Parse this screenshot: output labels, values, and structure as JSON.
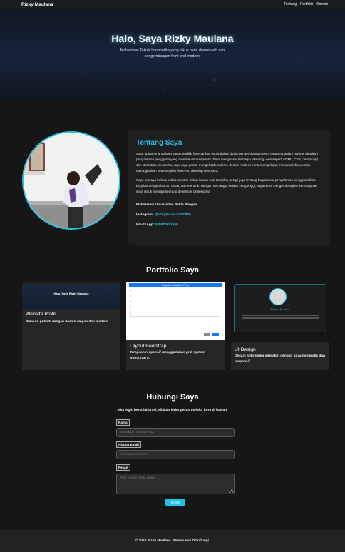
{
  "navbar": {
    "brand": "Rizky Maulana",
    "links": [
      "Tentang",
      "Portfolio",
      "Kontak"
    ]
  },
  "hero": {
    "title": "Halo, Saya Rizky Maulana",
    "subtitle": "Mahasiswa Teknik Informatika yang fokus pada desain web dan pengembangan front-end modern."
  },
  "about": {
    "title": "Tentang Saya",
    "paragraph1": "Saya adalah mahasiswa yang memiliki ketertarikan tinggi dalam dunia pengembangan web, terutama dalam hal menciptakan pengalaman pengguna yang menarik dan responsif. Saya menguasai berbagai teknologi web seperti HTML, CSS, JavaScript, dan Bootstrap. Selain itu, saya juga gemar mengeksplorasi tren desain modern serta mempelajari framework baru untuk meningkatkan keterampilan front-end development saya.",
    "paragraph2": "Saya percaya bahwa setiap website bukan hanya soal tampilan, tetapi juga tentang bagaimana pengalaman pengguna bisa berjalan dengan lancar, cepat, dan menarik. Dengan semangat belajar yang tinggi, saya terus mengembangkan kemampuan saya untuk menjadi seorang developer profesional.",
    "university": "Mahasiswa Universitas Pelita Bangsa",
    "instagram_label": "Instagram:",
    "instagram_value": "@rizkymaulana270805",
    "whatsapp_label": "WhatsApp:",
    "whatsapp_value": "085872651650"
  },
  "portfolio": {
    "title": "Portfolio Saya",
    "items": [
      {
        "title": "Website Profil",
        "desc": "Website pribadi dengan desain elegan dan modern.",
        "thumb_text": "Halo, Saya Rizky Maulana"
      },
      {
        "title": "Layout Bootstrap",
        "desc": "Tampilan responsif menggunakan grid system Bootstrap 5.",
        "thumb_text": "Register Validation Form"
      },
      {
        "title": "UI Design",
        "desc": "Desain antarmuka interaktif dengan gaya minimalis dan responsif.",
        "thumb_text": "Rizky Maulana"
      }
    ]
  },
  "contact": {
    "title": "Hubungi Saya",
    "intro": "Jika ingin berkolaborasi, silakan kirim pesan melalui form di bawah.",
    "name_label": "Nama",
    "name_placeholder": "Masukkan nama Anda",
    "email_label": "Alamat Email",
    "email_placeholder": "nama@email.com",
    "message_label": "Pesan",
    "message_placeholder": "Tulis pesan Anda di sini",
    "submit_label": "Kirim"
  },
  "footer": {
    "text": "© 2025 Rizky Maulana. Semua Hak Dilindungi."
  },
  "colors": {
    "accent": "#29c0e8",
    "background": "#161616",
    "card": "#262626"
  }
}
